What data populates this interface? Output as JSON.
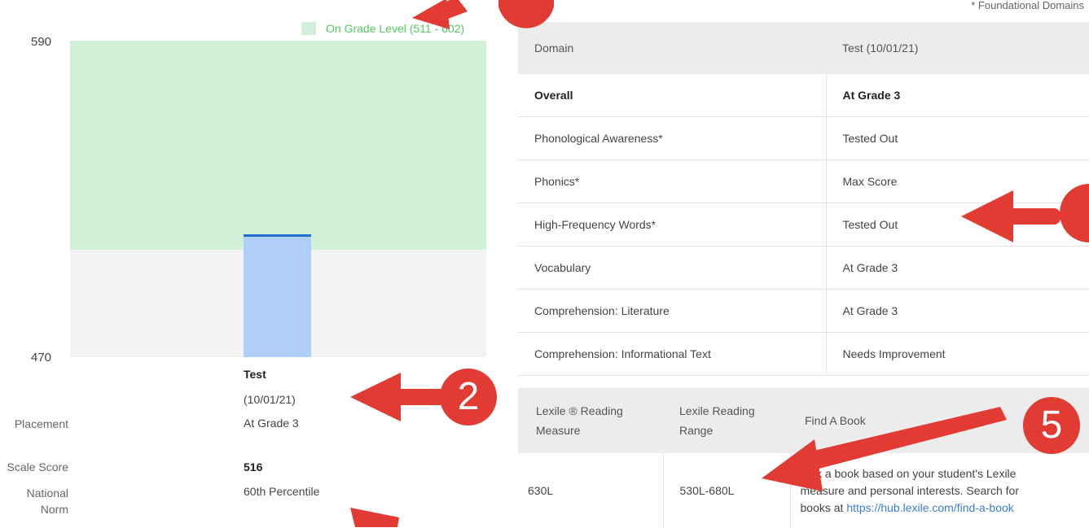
{
  "chart": {
    "legend": "On Grade Level (511 - 602)",
    "y_top_label": "590",
    "y_bottom_label": "470",
    "column_heading": "Test",
    "column_date": "(10/01/21)",
    "placement_label": "Placement",
    "placement_value": "At Grade 3",
    "scale_score_label": "Scale Score",
    "scale_score_value": "516",
    "national_norm_label_1": "National",
    "national_norm_label_2": "Norm",
    "national_norm_value": "60th Percentile",
    "colors": {
      "on_grade_band": "#d3f0d8",
      "below_band": "#f4f2f4",
      "bar": "#b0cefa",
      "bar_line": "#1e6fd1"
    }
  },
  "chart_data": {
    "type": "bar",
    "categories": [
      "Test (10/01/21)"
    ],
    "values": [
      516
    ],
    "ylim": [
      470,
      590
    ],
    "bands": [
      {
        "name": "On Grade Level (511 - 602)",
        "from": 511,
        "to": 602
      }
    ],
    "legend_position": "top-right"
  },
  "domains": {
    "note": "* Foundational Domains",
    "header": {
      "domain": "Domain",
      "test": "Test (10/01/21)"
    },
    "rows": [
      {
        "domain": "Overall",
        "result": "At Grade 3"
      },
      {
        "domain": "Phonological Awareness*",
        "result": "Tested Out"
      },
      {
        "domain": "Phonics*",
        "result": "Max Score"
      },
      {
        "domain": "High-Frequency Words*",
        "result": "Tested Out"
      },
      {
        "domain": "Vocabulary",
        "result": "At Grade 3"
      },
      {
        "domain": "Comprehension: Literature",
        "result": "At Grade 3"
      },
      {
        "domain": "Comprehension: Informational Text",
        "result": "Needs Improvement"
      }
    ]
  },
  "lexile": {
    "header": {
      "measure_1": "Lexile ® Reading",
      "measure_2": "Measure",
      "range_1": "Lexile Reading",
      "range_2": "Range",
      "find": "Find A Book"
    },
    "measure": "630L",
    "range": "530L-680L",
    "find_text_1": "Pick a book based on your student's Lexile",
    "find_text_2": "measure and personal interests. Search for",
    "find_text_3": "books at ",
    "find_link": "https://hub.lexile.com/find-a-book"
  },
  "annotations": {
    "badge_2": "2",
    "badge_5": "5",
    "color": "#e13b33"
  }
}
